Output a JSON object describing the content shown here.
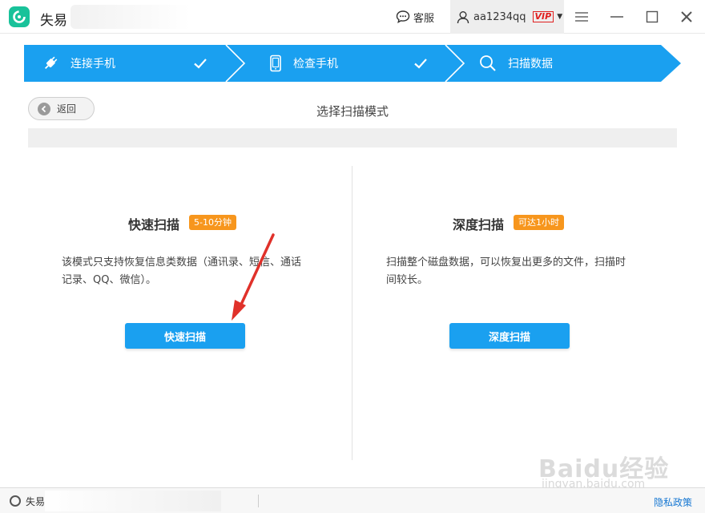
{
  "titlebar": {
    "app_title": "失易",
    "service_label": "客服",
    "username": "aa1234qq",
    "vip_label": "VIP"
  },
  "steps": [
    {
      "label": "连接手机",
      "icon": "plug-icon",
      "done": true
    },
    {
      "label": "检查手机",
      "icon": "phone-icon",
      "done": true
    },
    {
      "label": "扫描数据",
      "icon": "search-icon",
      "done": false
    }
  ],
  "colors": {
    "step_bar": "#1aa0f0",
    "scan_button": "#1aa0f0",
    "badge": "#f7961d",
    "logo": "#19c29a",
    "privacy_link": "#1677d2"
  },
  "nav": {
    "back_label": "返回",
    "page_title": "选择扫描模式"
  },
  "modes": {
    "quick": {
      "title": "快速扫描",
      "badge": "5-10分钟",
      "desc_line1": "该模式只支持恢复信息类数据（通讯录、短信、通话",
      "desc_line2": "记录、QQ、微信）。",
      "button": "快速扫描"
    },
    "deep": {
      "title": "深度扫描",
      "badge": "可达1小时",
      "desc_line1": "扫描整个磁盘数据，可以恢复出更多的文件，扫描时",
      "desc_line2": "间较长。",
      "button": "深度扫描"
    }
  },
  "statusbar": {
    "app_name": "失易",
    "privacy_label": "隐私政策"
  },
  "watermark": {
    "main": "Baidu经验",
    "sub": "jingyan.baidu.com"
  }
}
